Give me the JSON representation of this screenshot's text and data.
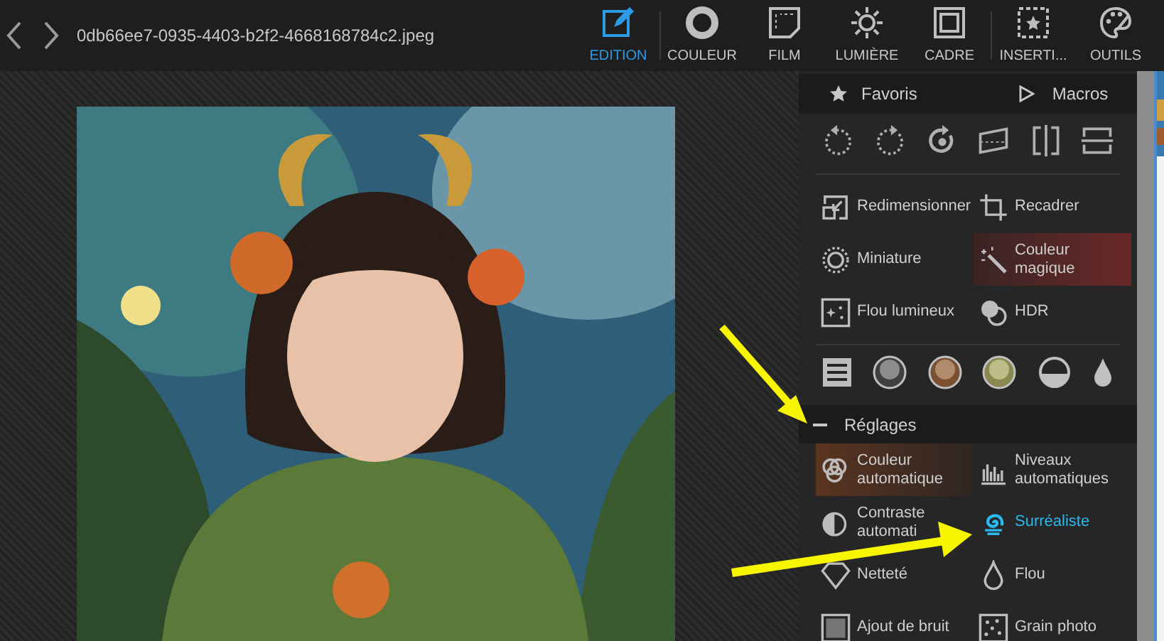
{
  "toolbar": {
    "filename": "0db66ee7-0935-4403-b2f2-4668168784c2.jpeg",
    "tabs": [
      {
        "label": "EDITION",
        "selected": true
      },
      {
        "label": "COULEUR",
        "selected": false
      },
      {
        "label": "FILM",
        "selected": false
      },
      {
        "label": "LUMIÈRE",
        "selected": false
      },
      {
        "label": "CADRE",
        "selected": false
      },
      {
        "label": "INSERTI...",
        "selected": false
      },
      {
        "label": "OUTILS",
        "selected": false
      }
    ]
  },
  "panel": {
    "favorites": "Favoris",
    "macros": "Macros",
    "tools": [
      {
        "label": "Redimensionner",
        "highlighted": false,
        "selected": false
      },
      {
        "label": "Recadrer",
        "highlighted": false,
        "selected": false
      },
      {
        "label": "Miniature",
        "highlighted": false,
        "selected": false
      },
      {
        "label": "Couleur magique",
        "highlighted": true,
        "selected": false
      },
      {
        "label": "Flou lumineux",
        "highlighted": false,
        "selected": false
      },
      {
        "label": "HDR",
        "highlighted": false,
        "selected": false
      }
    ],
    "section": {
      "title": "Réglages",
      "expanded": true,
      "tools": [
        {
          "label": "Couleur automatique",
          "highlighted": true,
          "selected": false
        },
        {
          "label": "Niveaux automatiques",
          "highlighted": false,
          "selected": false
        },
        {
          "label": "Contraste automati",
          "highlighted": false,
          "selected": false
        },
        {
          "label": "Surréaliste",
          "highlighted": false,
          "selected": true
        },
        {
          "label": "Netteté",
          "highlighted": false,
          "selected": false
        },
        {
          "label": "Flou",
          "highlighted": false,
          "selected": false
        },
        {
          "label": "Ajout de bruit",
          "highlighted": false,
          "selected": false
        },
        {
          "label": "Grain photo",
          "highlighted": false,
          "selected": false
        }
      ]
    }
  }
}
